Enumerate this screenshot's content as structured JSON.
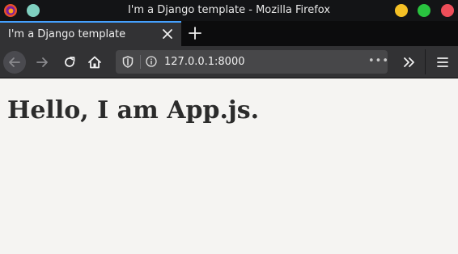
{
  "window": {
    "title": "I'm a Django template - Mozilla Firefox"
  },
  "tabs": [
    {
      "label": "I'm a Django template",
      "active": true
    }
  ],
  "navbar": {
    "url": "127.0.0.1:8000",
    "page_actions": "•••"
  },
  "page": {
    "heading": "Hello, I am App.js."
  },
  "colors": {
    "titlebar": "#131416",
    "tab_active": "#323234",
    "tab_indicator": "#45a1ff",
    "urlbar": "#474749",
    "minimize": "#f4c025",
    "maximize": "#29c33f",
    "close": "#ee4e59",
    "page_background": "#f5f4f2"
  },
  "icons": [
    "firefox-logo-icon",
    "teal-dot-icon",
    "close-tab-icon",
    "new-tab-icon",
    "back-icon",
    "forward-icon",
    "reload-icon",
    "home-icon",
    "shield-icon",
    "info-icon",
    "overflow-icon",
    "menu-icon"
  ]
}
